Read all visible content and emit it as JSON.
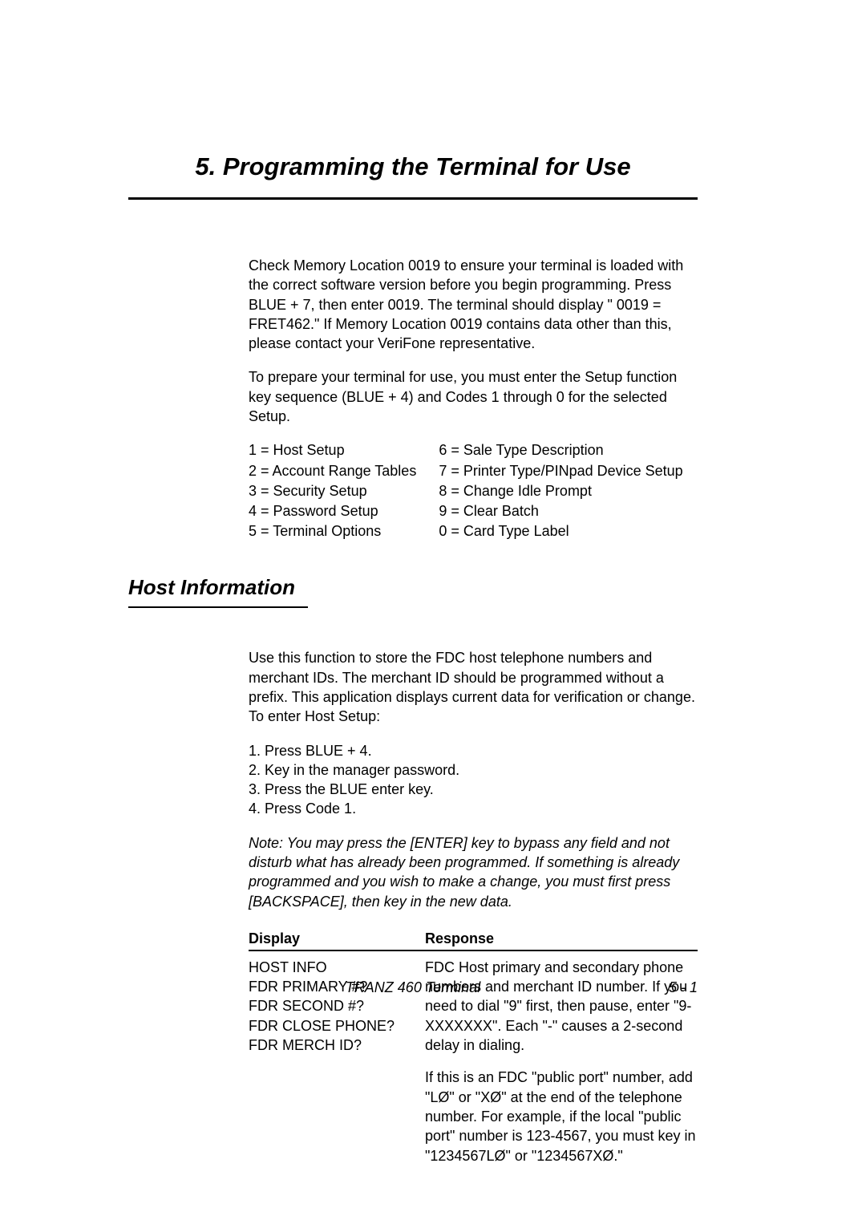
{
  "chapter_title": "5.  Programming the Terminal for Use",
  "intro_para1": "Check Memory Location 0019 to ensure your terminal is loaded with the correct software version before you begin programming.  Press BLUE + 7, then enter 0019.  The terminal should display \" 0019 = FRET462.\"  If Memory Location 0019 contains data other than this, please contact your VeriFone representative.",
  "intro_para2": "To prepare your terminal for use, you must enter the Setup function key sequence (BLUE + 4) and Codes 1 through 0 for the selected Setup.",
  "codes_left": [
    "1 = Host Setup",
    "2 = Account Range Tables",
    "3 = Security Setup",
    "4 = Password Setup",
    "5 = Terminal Options"
  ],
  "codes_right": [
    "6 = Sale Type Description",
    "7 = Printer Type/PINpad Device Setup",
    "8 = Change Idle Prompt",
    "9 = Clear Batch",
    "0 = Card Type Label"
  ],
  "section_title": "Host Information",
  "host_intro": "Use this function to store the FDC host telephone numbers and merchant IDs. The merchant ID should be programmed without a prefix. This application displays current data for verification or change. To enter Host Setup:",
  "steps": [
    "1.  Press BLUE + 4.",
    "2.  Key in the manager password.",
    "3.  Press the BLUE enter key.",
    "4.  Press Code 1."
  ],
  "note": "Note:  You may press the [ENTER] key to bypass any field and not disturb what has already been programmed. If something is already programmed and you wish to make a change, you must first press [BACKSPACE], then key in the new data.",
  "table": {
    "head_display": "Display",
    "head_response": "Response",
    "row1_display": "HOST INFO\nFDR PRIMARY #?\nFDR SECOND #?\nFDR CLOSE PHONE?\nFDR MERCH ID?",
    "row1_response": "FDC Host primary and secondary phone numbers and merchant ID number.  If you need to dial \"9\" first, then pause, enter \"9-XXXXXXX\".  Each \"-\" causes a 2-second delay in dialing.",
    "row2_response": "If this is an FDC \"public port\" number, add \"LØ\"  or \"XØ\" at the end of the telephone number.  For example, if the local \"public port\" number is 123-4567, you must key in \"1234567LØ\" or \"1234567XØ.\""
  },
  "footer_center": "TRANZ 460 Terminal",
  "footer_pagenum": "5 - 1"
}
